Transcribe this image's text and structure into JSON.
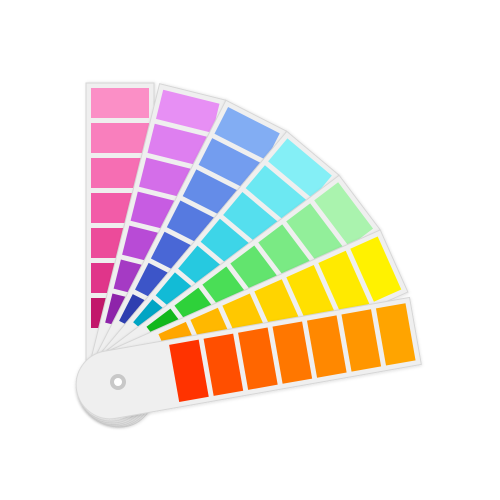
{
  "image": {
    "subject": "color-swatch-fan",
    "background_color": "#ffffff",
    "card_color": "#efefef",
    "card_edge_color": "#d6d6d6",
    "pivot_ring_color": "#c8c8c8",
    "pivot_hole_color": "#ffffff",
    "chip_color_order": "inner-to-outer",
    "strips": [
      {
        "name": "pink",
        "chips": [
          "#c2186b",
          "#e0358a",
          "#ec4b9a",
          "#f25ca8",
          "#f66eb3",
          "#f97fbd",
          "#fb8fc6"
        ]
      },
      {
        "name": "magenta",
        "chips": [
          "#8e24aa",
          "#a53ac4",
          "#b84bd6",
          "#c75ce2",
          "#d46ee9",
          "#de7ff0",
          "#e78ff4"
        ]
      },
      {
        "name": "indigo-blue",
        "chips": [
          "#2e3fb0",
          "#3c55c8",
          "#4967d6",
          "#567ae0",
          "#648ce8",
          "#739def",
          "#82adf3"
        ]
      },
      {
        "name": "cyan",
        "chips": [
          "#00a5c4",
          "#12bbd6",
          "#26c9e0",
          "#3dd5e8",
          "#55dfee",
          "#6ce8f2",
          "#84eff6"
        ]
      },
      {
        "name": "green",
        "chips": [
          "#12b81c",
          "#2ed13a",
          "#4ade56",
          "#62e46e",
          "#7aea84",
          "#92ef9a",
          "#aaf3ae"
        ]
      },
      {
        "name": "yellow",
        "chips": [
          "#ffa600",
          "#ffb800",
          "#ffc800",
          "#ffd400",
          "#ffe000",
          "#ffea00",
          "#fff200"
        ]
      },
      {
        "name": "orange",
        "chips": [
          "#ff3300",
          "#ff4f00",
          "#ff6600",
          "#ff7700",
          "#ff8800",
          "#ff9600",
          "#ffa400"
        ]
      }
    ]
  }
}
